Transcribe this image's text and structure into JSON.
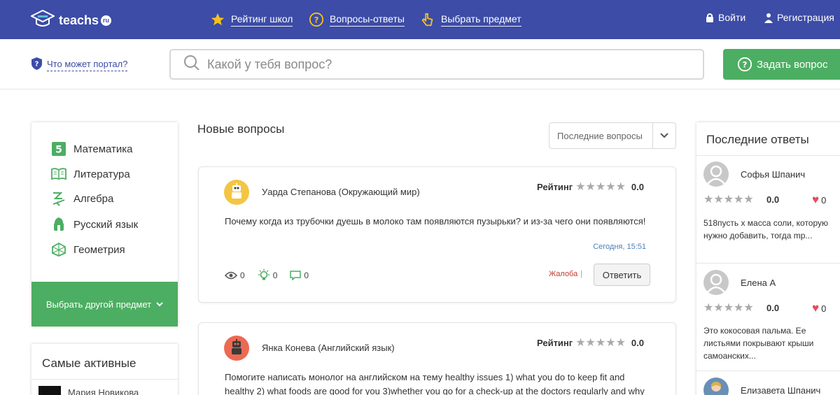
{
  "header": {
    "logo_text": "teachs",
    "logo_badge": "ru",
    "nav": [
      {
        "label": "Рейтинг школ",
        "icon": "star-icon"
      },
      {
        "label": "Вопросы-ответы",
        "icon": "question-icon"
      },
      {
        "label": "Выбрать предмет",
        "icon": "pointer-icon"
      }
    ],
    "login": "Войти",
    "register": "Регистрация"
  },
  "search_strip": {
    "portal_link": "Что может портал?",
    "search_placeholder": "Какой у тебя вопрос?",
    "ask_button": "Задать вопрос"
  },
  "subjects": {
    "items": [
      {
        "label": "Математика",
        "icon": "math-five-icon"
      },
      {
        "label": "Литература",
        "icon": "book-icon"
      },
      {
        "label": "Алгебра",
        "icon": "algebra-icon"
      },
      {
        "label": "Русский язык",
        "icon": "russian-icon"
      },
      {
        "label": "Геометрия",
        "icon": "geometry-icon"
      }
    ],
    "choose_other": "Выбрать другой предмет"
  },
  "most_active": {
    "title": "Самые активные",
    "users": [
      {
        "name": "Мария Новикова"
      }
    ]
  },
  "feed": {
    "title": "Новые вопросы",
    "sort_label": "Последние вопросы",
    "questions": [
      {
        "author": "Уарда Степанова (Окружающий мир)",
        "rating_label": "Рейтинг",
        "rating_value": "0.0",
        "stars": 0,
        "text": "Почему когда из трубочки дуешь в молоко там появляются пузырьки? и из-за чего они появляются!",
        "time": "Сегодня, 15:51",
        "views": "0",
        "answers": "0",
        "comments": "0",
        "complain": "Жалоба",
        "reply": "Ответить"
      },
      {
        "author": "Янка Конева (Английский язык)",
        "rating_label": "Рейтинг",
        "rating_value": "0.0",
        "stars": 0,
        "text": "Помогите написать монолог на английском на тему healthy issues 1) what you do to keep fit and healthy 2) what foods are good for you 3)whether you go for a check-up at the doctors regularly and why"
      }
    ]
  },
  "last_answers": {
    "title": "Последние ответы",
    "items": [
      {
        "name": "Софья Шпанич",
        "rating": "0.0",
        "likes": "0",
        "text": "518пусть х масса соли, которую нужно добавить, тогда mp..."
      },
      {
        "name": "Елена А",
        "rating": "0.0",
        "likes": "0",
        "text": "Это кокосовая пальма. Ее листьями покрывают крыши самоанских..."
      },
      {
        "name": "Елизавета Шпанич"
      }
    ]
  },
  "colors": {
    "header_bg": "#3c4ca7",
    "accent_green": "#4cae62",
    "link_blue": "#3c4ca7",
    "complain_red": "#c0392b"
  }
}
